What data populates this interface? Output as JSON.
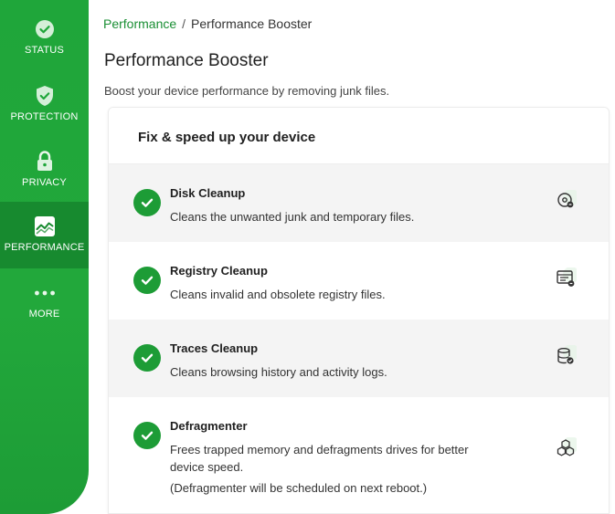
{
  "sidebar": {
    "items": [
      {
        "label": "STATUS",
        "icon": "check-circle-icon"
      },
      {
        "label": "PROTECTION",
        "icon": "shield-check-icon"
      },
      {
        "label": "PRIVACY",
        "icon": "lock-icon"
      },
      {
        "label": "PERFORMANCE",
        "icon": "performance-chart-icon",
        "active": true
      },
      {
        "label": "MORE",
        "icon": "more-dots-icon"
      }
    ]
  },
  "breadcrumb": {
    "parent": "Performance",
    "separator": "/",
    "current": "Performance Booster"
  },
  "page": {
    "title": "Performance Booster",
    "subtitle": "Boost your device performance by removing junk files."
  },
  "card": {
    "title": "Fix & speed up your device",
    "items": [
      {
        "title": "Disk Cleanup",
        "description": "Cleans the unwanted junk and temporary files.",
        "icon": "disk-cleanup-icon"
      },
      {
        "title": "Registry Cleanup",
        "description": "Cleans invalid and obsolete registry files.",
        "icon": "registry-cleanup-icon"
      },
      {
        "title": "Traces Cleanup",
        "description": "Cleans browsing history and activity logs.",
        "icon": "traces-cleanup-icon"
      },
      {
        "title": "Defragmenter",
        "description": "Frees trapped memory and defragments drives for better device speed.",
        "note": "(Defragmenter will be scheduled on next reboot.)",
        "icon": "defragmenter-icon"
      }
    ]
  },
  "colors": {
    "brand_green": "#1fa63a",
    "active_nav": "#178a2f",
    "link_green": "#1a8f34"
  }
}
